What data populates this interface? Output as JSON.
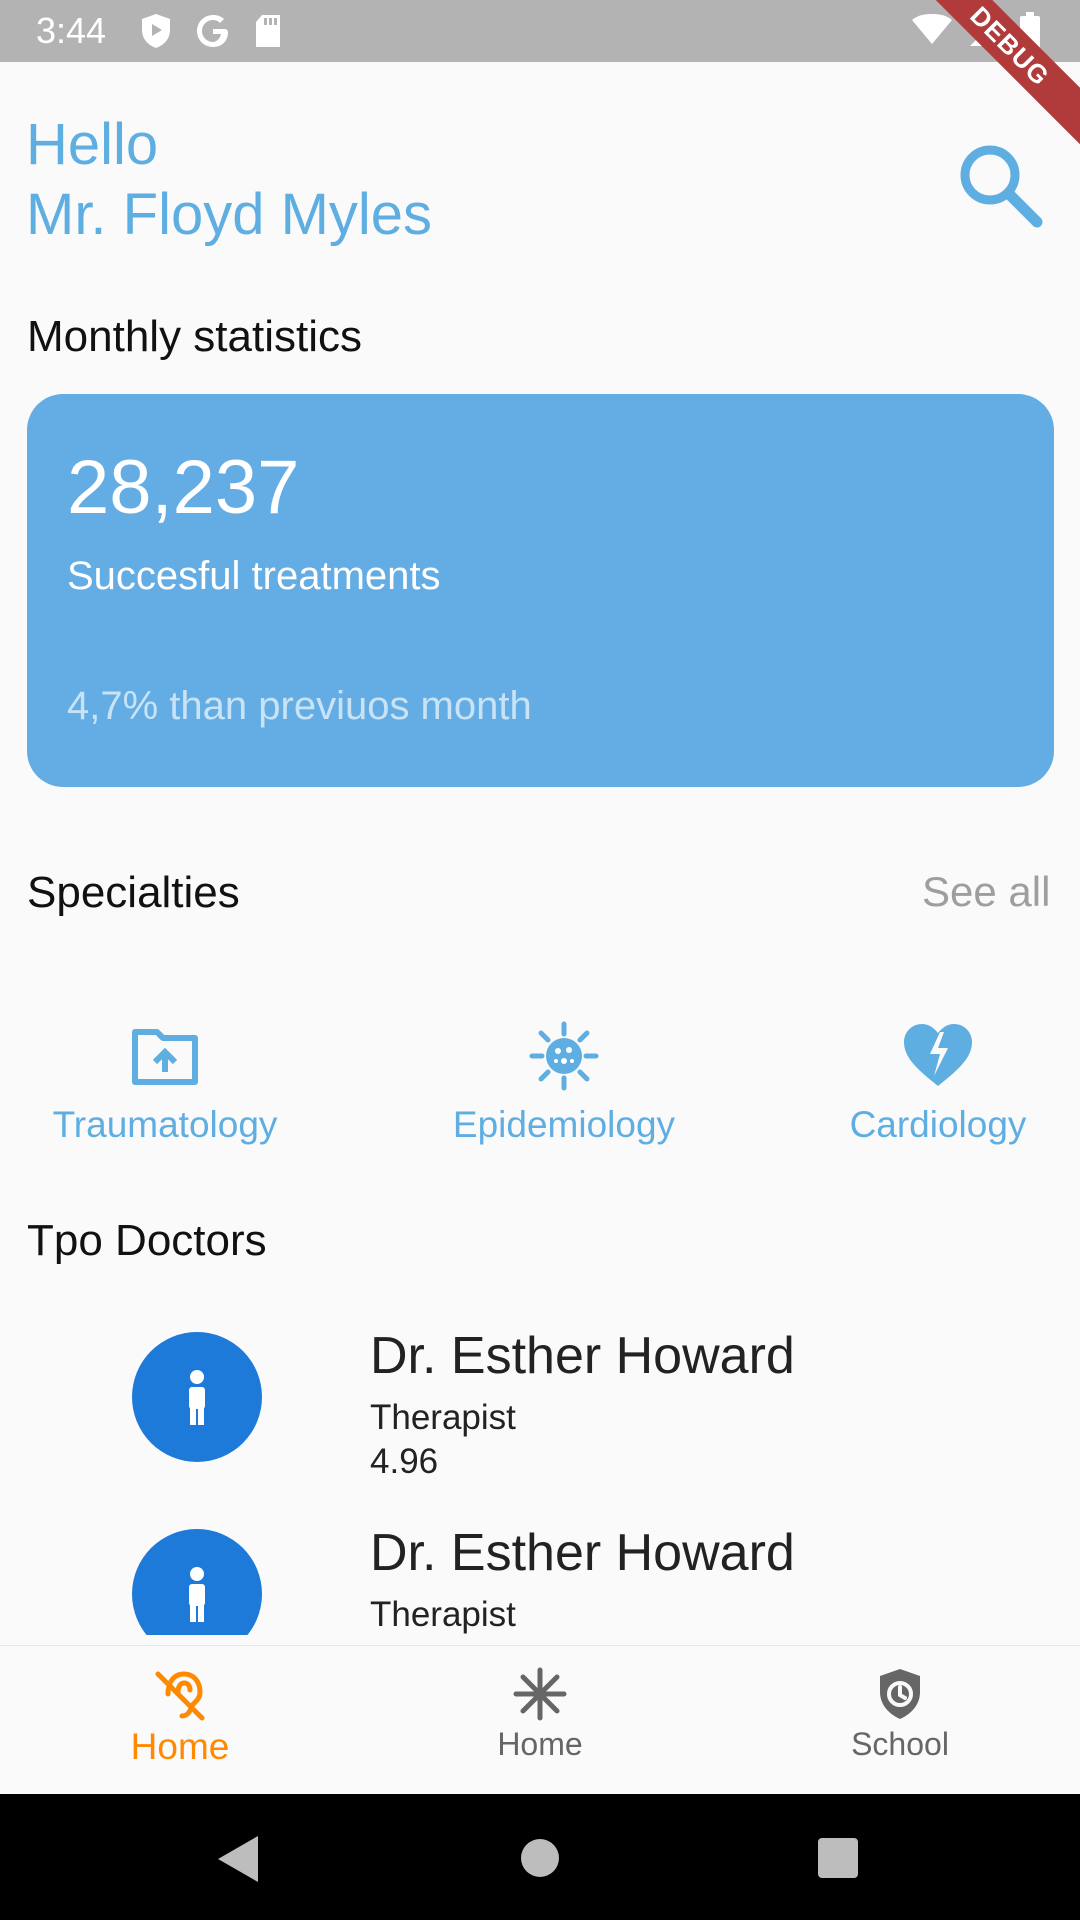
{
  "status_bar": {
    "time": "3:44",
    "debug_label": "DEBUG"
  },
  "greeting": {
    "line1": "Hello",
    "line2": "Mr. Floyd Myles"
  },
  "stats": {
    "title": "Monthly statistics",
    "value": "28,237",
    "label": "Succesful treatments",
    "change": "4,7% than previuos month"
  },
  "specialties": {
    "title": "Specialties",
    "see_all": "See all",
    "items": [
      {
        "label": "Traumatology",
        "icon": "folder-upload-icon"
      },
      {
        "label": "Epidemiology",
        "icon": "virus-icon"
      },
      {
        "label": "Cardiology",
        "icon": "broken-heart-icon"
      }
    ]
  },
  "doctors": {
    "title": "Tpo Doctors",
    "items": [
      {
        "name": "Dr. Esther Howard",
        "role": "Therapist",
        "rating": "4.96"
      },
      {
        "name": "Dr. Esther Howard",
        "role": "Therapist"
      }
    ]
  },
  "bottom_nav": {
    "items": [
      {
        "label": "Home",
        "icon": "hearing-disabled-icon",
        "active": true
      },
      {
        "label": "Home",
        "icon": "snowflake-icon",
        "active": false
      },
      {
        "label": "School",
        "icon": "shield-clock-icon",
        "active": false
      }
    ]
  },
  "colors": {
    "accent": "#63ade4",
    "active_nav": "#ff8a00",
    "avatar": "#1e7ad8"
  }
}
